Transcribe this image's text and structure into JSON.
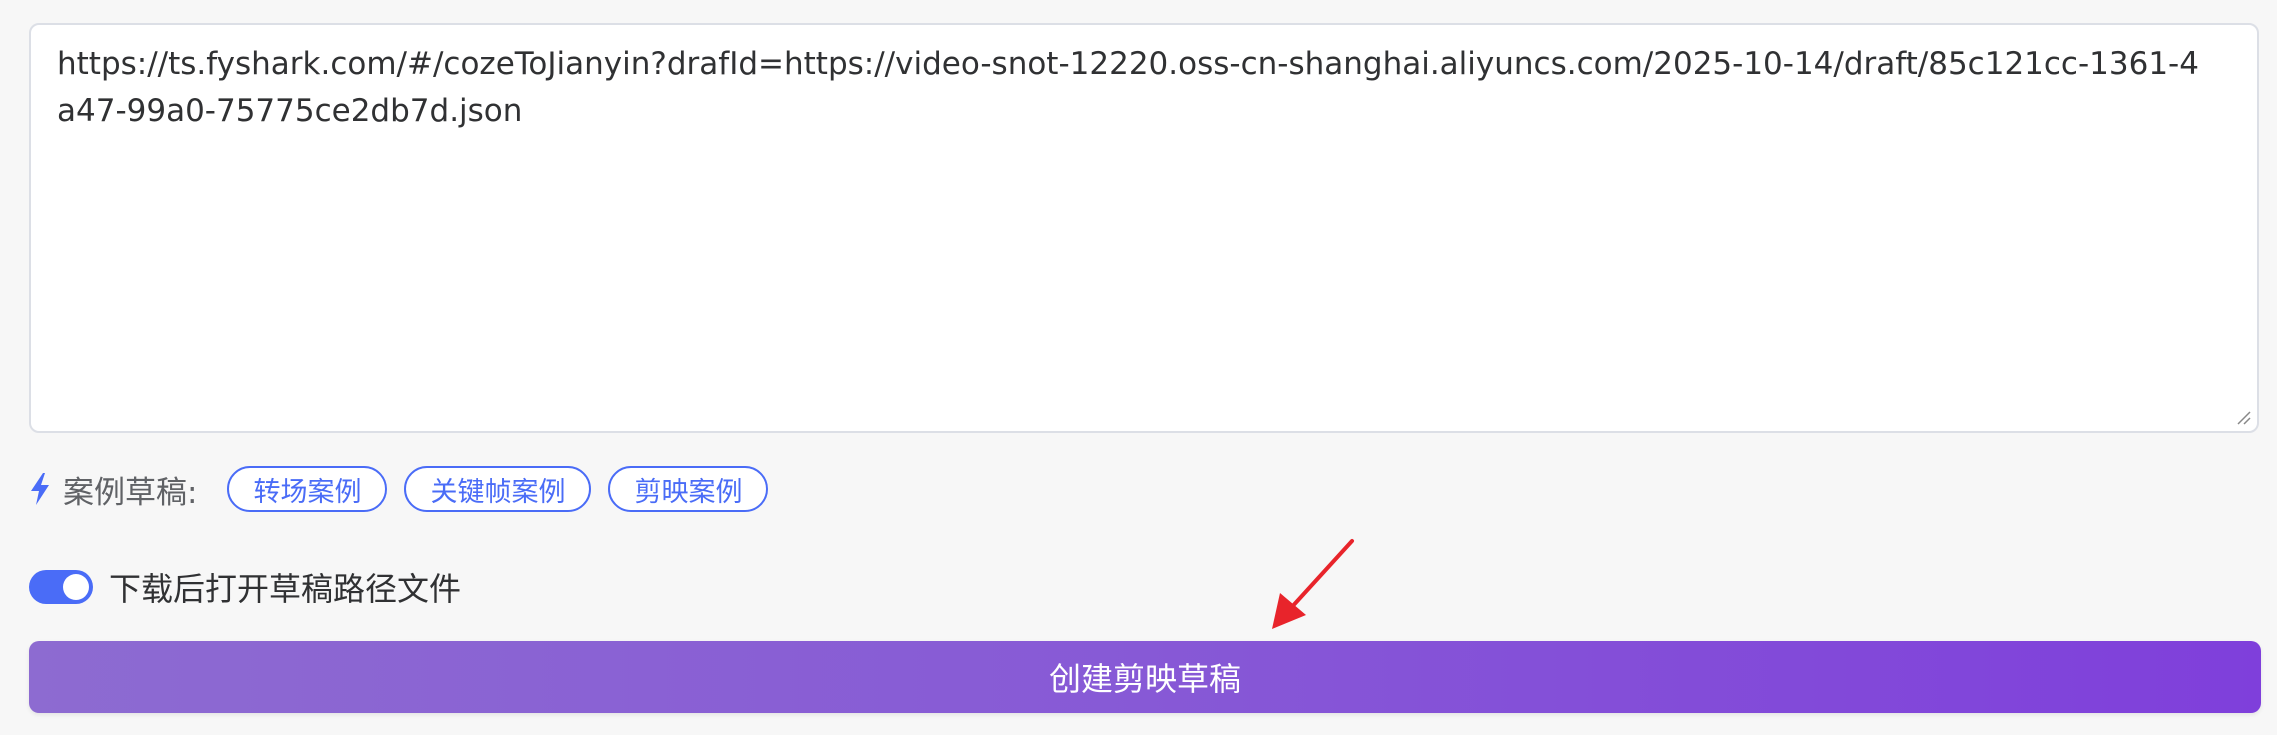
{
  "draft_input": {
    "value": "https://ts.fyshark.com/#/cozeToJianyin?drafId=https://video-snot-12220.oss-cn-shanghai.aliyuncs.com/2025-10-14/draft/85c121cc-1361-4a47-99a0-75775ce2db7d.json"
  },
  "examples": {
    "icon": "lightning-icon",
    "label": "案例草稿:",
    "chips": [
      {
        "label": "转场案例"
      },
      {
        "label": "关键帧案例"
      },
      {
        "label": "剪映案例"
      }
    ]
  },
  "open_after_download": {
    "enabled": true,
    "label": "下载后打开草稿路径文件"
  },
  "create_button": {
    "label": "创建剪映草稿"
  },
  "colors": {
    "accent": "#4a6cf7",
    "button_gradient_start": "#8d6bd1",
    "button_gradient_end": "#7f3fdb",
    "annotation_arrow": "#e8242b"
  }
}
